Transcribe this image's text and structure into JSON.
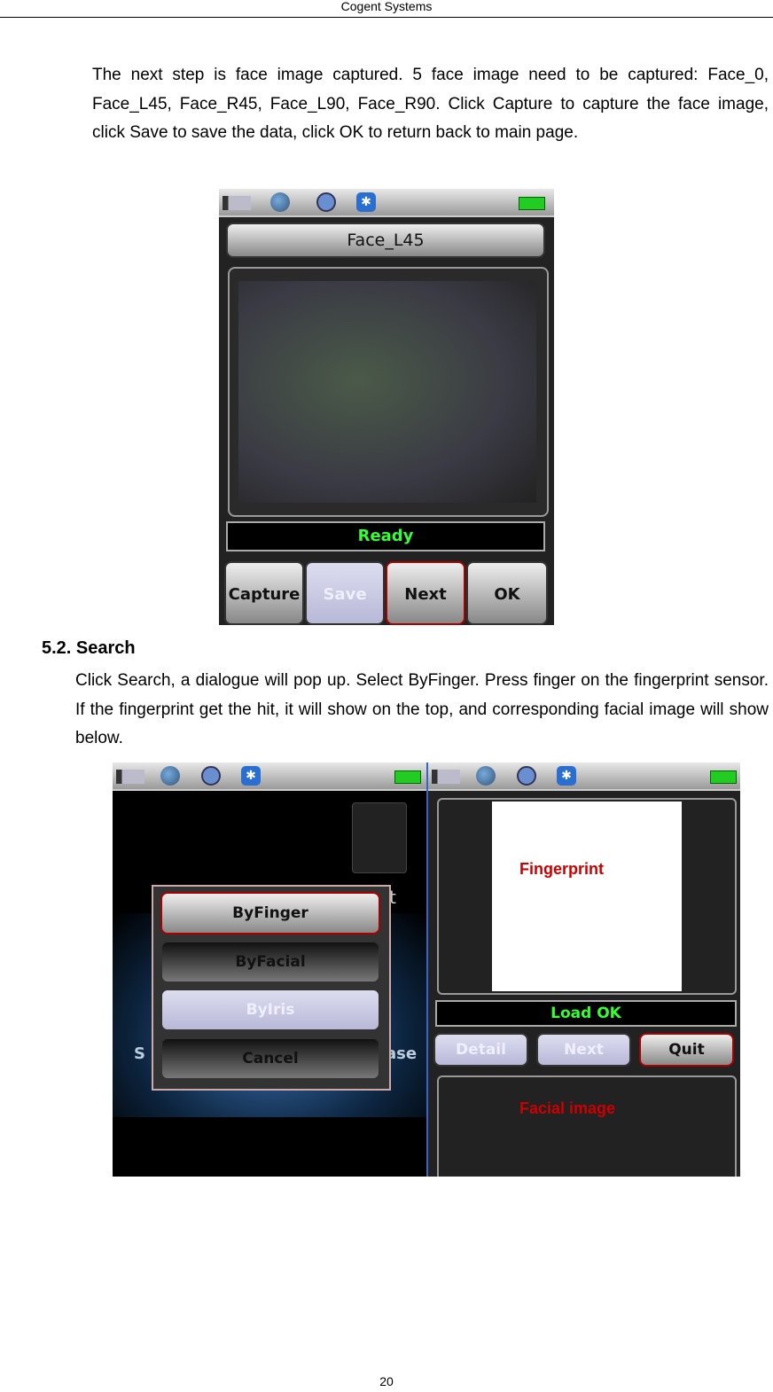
{
  "header": "Cogent Systems",
  "paragraph1": "The next step is face image captured. 5 face image need to be captured: Face_0, Face_L45, Face_R45, Face_L90, Face_R90. Click Capture to capture the face image, click Save to save the data, click OK to return back to main page.",
  "screen1": {
    "title": "Face_L45",
    "status": "Ready",
    "buttons": [
      "Capture",
      "Save",
      "Next",
      "OK"
    ]
  },
  "section_heading": "5.2. Search",
  "paragraph2": "Click Search, a dialogue will pop up. Select ByFinger. Press finger on the fingerprint sensor. If the fingerprint get the hit, it will show on the top, and corresponding facial image will show below.",
  "screen2": {
    "dialog": [
      "ByFinger",
      "ByFacial",
      "ByIris",
      "Cancel"
    ],
    "bg_fragments": [
      "t",
      "S",
      "ase"
    ]
  },
  "screen3": {
    "fingerprint_label": "Fingerprint",
    "status": "Load OK",
    "buttons": [
      "Detail",
      "Next",
      "Quit"
    ],
    "facial_label": "Facial image"
  },
  "page_number": "20"
}
